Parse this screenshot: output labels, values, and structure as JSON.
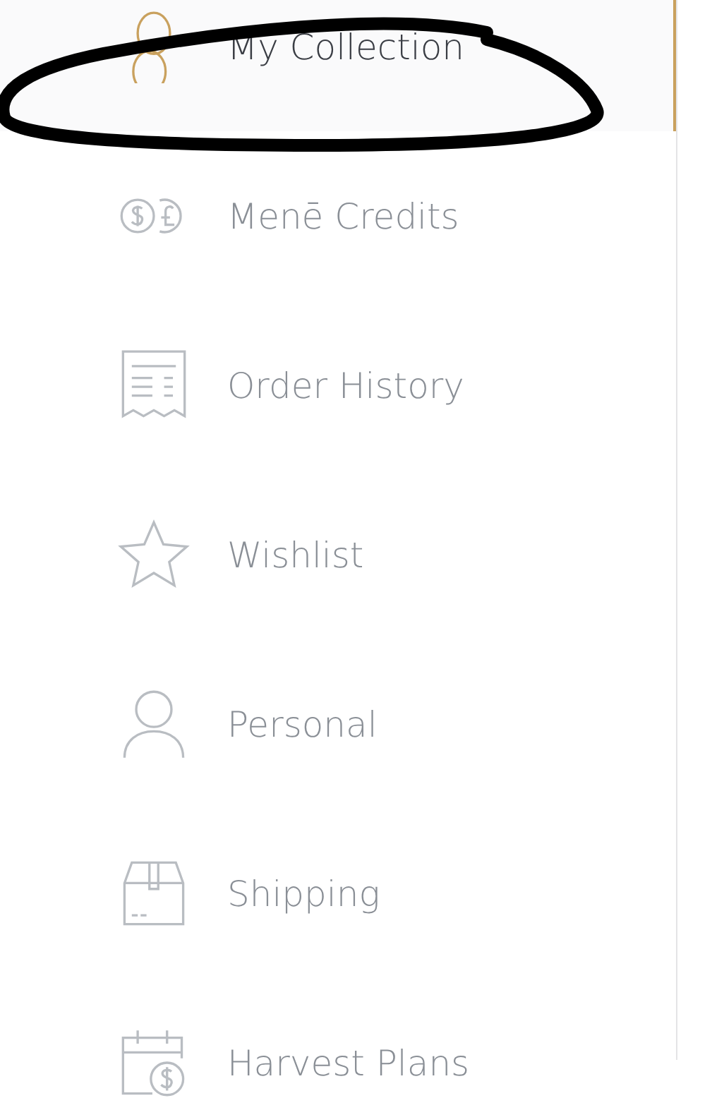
{
  "menu": {
    "items": [
      {
        "label": "My Collection",
        "selected": true
      },
      {
        "label": "Menē Credits",
        "selected": false
      },
      {
        "label": "Order History",
        "selected": false
      },
      {
        "label": "Wishlist",
        "selected": false
      },
      {
        "label": "Personal",
        "selected": false
      },
      {
        "label": "Shipping",
        "selected": false
      },
      {
        "label": "Harvest Plans",
        "selected": false
      }
    ]
  }
}
